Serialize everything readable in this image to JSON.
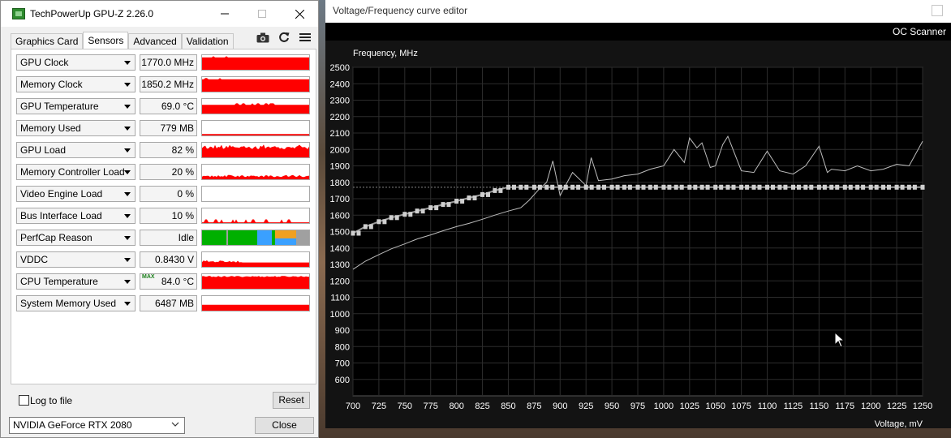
{
  "gpuz": {
    "title": "TechPowerUp GPU-Z 2.26.0",
    "tabs": [
      {
        "label": "Graphics Card",
        "active": false
      },
      {
        "label": "Sensors",
        "active": true
      },
      {
        "label": "Advanced",
        "active": false
      },
      {
        "label": "Validation",
        "active": false
      }
    ],
    "sensors": [
      {
        "name": "GPU Clock",
        "value": "1770.0 MHz",
        "level": 0.85,
        "pattern": "flat"
      },
      {
        "name": "Memory Clock",
        "value": "1850.2 MHz",
        "level": 0.85,
        "pattern": "flat"
      },
      {
        "name": "GPU Temperature",
        "value": "69.0 °C",
        "level": 0.6,
        "pattern": "temp"
      },
      {
        "name": "Memory Used",
        "value": "779 MB",
        "level": 0.1,
        "pattern": "low"
      },
      {
        "name": "GPU Load",
        "value": "82 %",
        "level": 0.8,
        "pattern": "noisy"
      },
      {
        "name": "Memory Controller Load",
        "value": "20 %",
        "level": 0.3,
        "pattern": "noisylow"
      },
      {
        "name": "Video Engine Load",
        "value": "0 %",
        "level": 0,
        "pattern": "none"
      },
      {
        "name": "Bus Interface Load",
        "value": "10 %",
        "level": 0.05,
        "pattern": "spiky"
      },
      {
        "name": "PerfCap Reason",
        "value": "Idle",
        "level": 1,
        "pattern": "perfcap"
      },
      {
        "name": "VDDC",
        "value": "0.8430 V",
        "level": 0.3,
        "pattern": "vddc"
      },
      {
        "name": "CPU Temperature",
        "value": "84.0 °C",
        "level": 0.8,
        "pattern": "cpu",
        "max_label": "MAX"
      },
      {
        "name": "System Memory Used",
        "value": "6487 MB",
        "level": 0.4,
        "pattern": "flatlow"
      }
    ],
    "log_to_file": "Log to file",
    "reset": "Reset",
    "gpu_name": "NVIDIA GeForce RTX 2080",
    "close": "Close",
    "colors": {
      "graph": "#ff0000",
      "perfcap_green": "#00b000",
      "perfcap_blue": "#3aa0ff",
      "perfcap_orange": "#f0a020",
      "perfcap_gray": "#a0a0a0"
    }
  },
  "vf_editor": {
    "title": "Voltage/Frequency curve editor",
    "oc_scanner": "OC Scanner",
    "chart_data": {
      "type": "line",
      "ylabel": "Frequency, MHz",
      "xlabel": "Voltage, mV",
      "xlim": [
        700,
        1250
      ],
      "ylim": [
        500,
        2500
      ],
      "x_ticks": [
        700,
        725,
        750,
        775,
        800,
        825,
        850,
        875,
        900,
        925,
        950,
        975,
        1000,
        1025,
        1050,
        1075,
        1100,
        1125,
        1150,
        1175,
        1200,
        1225,
        1250
      ],
      "y_ticks": [
        600,
        700,
        800,
        900,
        1000,
        1100,
        1200,
        1300,
        1400,
        1500,
        1600,
        1700,
        1800,
        1900,
        2000,
        2100,
        2200,
        2300,
        2400,
        2500
      ],
      "grid": true,
      "reference_line": 1770,
      "series": [
        {
          "role": "curve-points",
          "x": [
            700,
            712,
            725,
            737,
            750,
            762,
            775,
            787,
            800,
            812,
            825,
            837,
            850,
            862,
            875,
            887,
            900,
            912,
            925,
            937,
            950,
            962,
            975,
            987,
            1000,
            1012,
            1025,
            1037,
            1050,
            1062,
            1075,
            1087,
            1100,
            1112,
            1125,
            1137,
            1150,
            1162,
            1175,
            1187,
            1200,
            1212,
            1225,
            1237,
            1250
          ],
          "y": [
            1490,
            1530,
            1560,
            1585,
            1605,
            1625,
            1645,
            1665,
            1685,
            1705,
            1725,
            1750,
            1770,
            1770,
            1770,
            1770,
            1770,
            1770,
            1770,
            1770,
            1770,
            1770,
            1770,
            1770,
            1770,
            1770,
            1770,
            1770,
            1770,
            1770,
            1770,
            1770,
            1770,
            1770,
            1770,
            1770,
            1770,
            1770,
            1770,
            1770,
            1770,
            1770,
            1770,
            1770,
            1770
          ]
        },
        {
          "role": "measured",
          "x": [
            700,
            712,
            725,
            737,
            750,
            762,
            775,
            787,
            800,
            812,
            825,
            837,
            850,
            862,
            870,
            880,
            887,
            893,
            900,
            912,
            925,
            930,
            937,
            950,
            962,
            975,
            987,
            1000,
            1010,
            1020,
            1025,
            1032,
            1037,
            1045,
            1050,
            1057,
            1062,
            1075,
            1087,
            1100,
            1112,
            1125,
            1137,
            1150,
            1158,
            1162,
            1175,
            1187,
            1200,
            1212,
            1225,
            1237,
            1250
          ],
          "y": [
            1270,
            1320,
            1360,
            1395,
            1425,
            1455,
            1480,
            1505,
            1530,
            1550,
            1575,
            1600,
            1625,
            1645,
            1690,
            1760,
            1800,
            1930,
            1720,
            1860,
            1780,
            1950,
            1810,
            1820,
            1840,
            1850,
            1880,
            1900,
            2000,
            1920,
            2070,
            2010,
            2040,
            1890,
            1900,
            2030,
            2080,
            1870,
            1860,
            1990,
            1870,
            1850,
            1900,
            2020,
            1860,
            1880,
            1870,
            1900,
            1870,
            1880,
            1910,
            1900,
            2050
          ]
        }
      ]
    }
  }
}
